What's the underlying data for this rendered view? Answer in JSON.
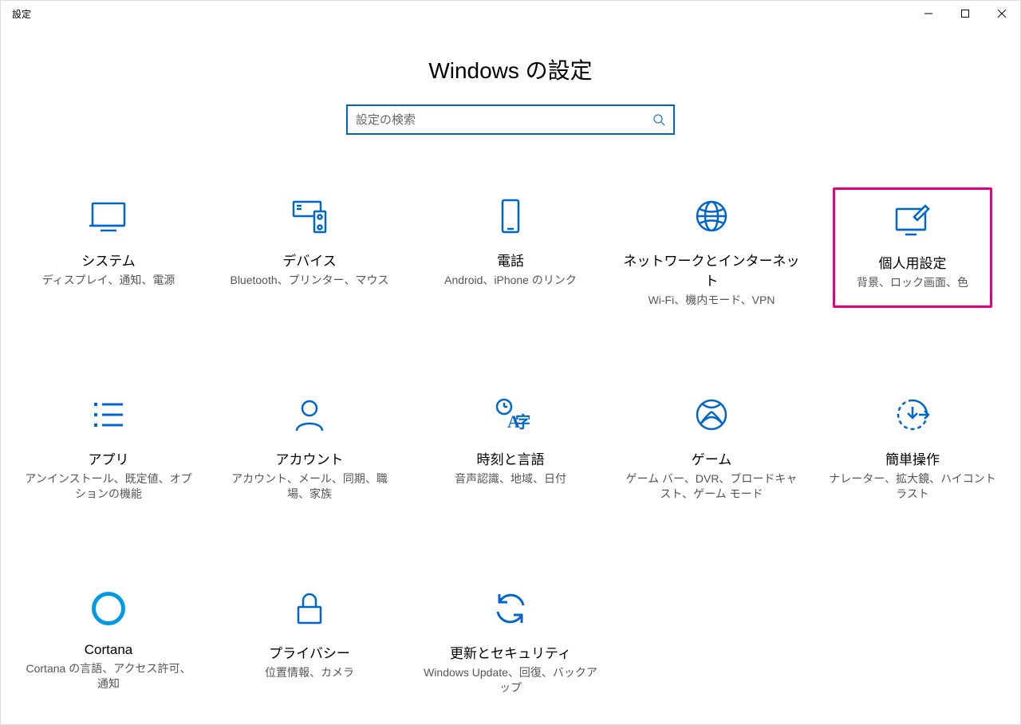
{
  "window": {
    "title": "設定"
  },
  "page": {
    "headline": "Windows の設定"
  },
  "search": {
    "placeholder": "設定の検索"
  },
  "tiles": [
    {
      "label": "システム",
      "desc": "ディスプレイ、通知、電源"
    },
    {
      "label": "デバイス",
      "desc": "Bluetooth、プリンター、マウス"
    },
    {
      "label": "電話",
      "desc": "Android、iPhone のリンク"
    },
    {
      "label": "ネットワークとインターネット",
      "desc": "Wi-Fi、機内モード、VPN"
    },
    {
      "label": "個人用設定",
      "desc": "背景、ロック画面、色"
    },
    {
      "label": "アプリ",
      "desc": "アンインストール、既定値、オプションの機能"
    },
    {
      "label": "アカウント",
      "desc": "アカウント、メール、同期、職場、家族"
    },
    {
      "label": "時刻と言語",
      "desc": "音声認識、地域、日付"
    },
    {
      "label": "ゲーム",
      "desc": "ゲーム バー、DVR、ブロードキャスト、ゲーム モード"
    },
    {
      "label": "簡単操作",
      "desc": "ナレーター、拡大鏡、ハイコントラスト"
    },
    {
      "label": "Cortana",
      "desc": "Cortana の言語、アクセス許可、通知"
    },
    {
      "label": "プライバシー",
      "desc": "位置情報、カメラ"
    },
    {
      "label": "更新とセキュリティ",
      "desc": "Windows Update、回復、バックアップ"
    }
  ]
}
